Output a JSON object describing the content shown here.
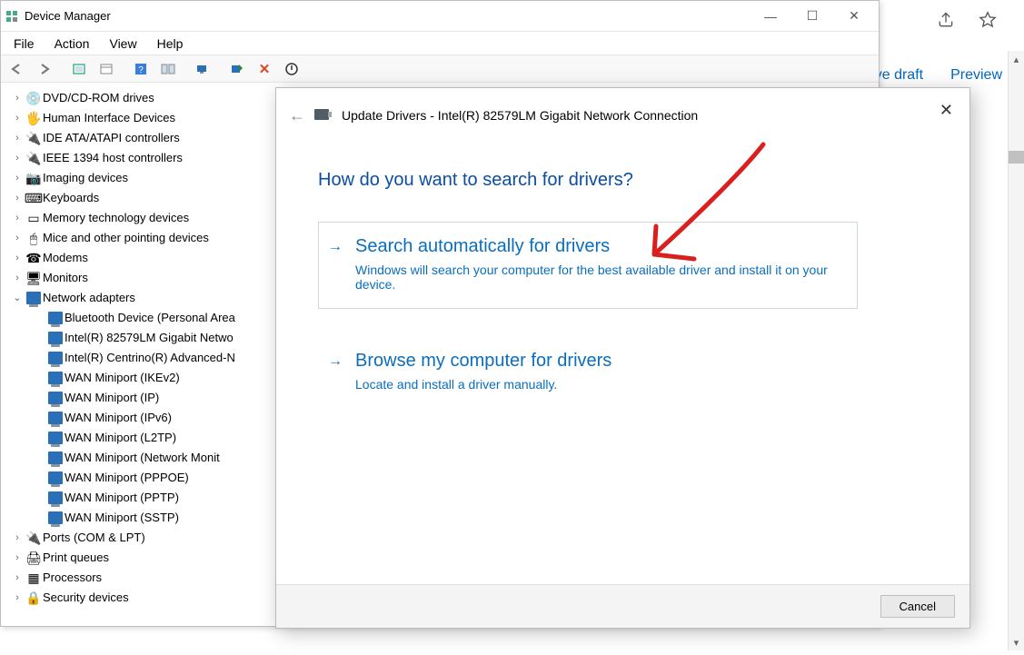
{
  "bg": {
    "link1": "ve draft",
    "link2": "Preview"
  },
  "window": {
    "title": "Device Manager",
    "menus": [
      "File",
      "Action",
      "View",
      "Help"
    ]
  },
  "tree": [
    {
      "icon": "disc",
      "label": "DVD/CD-ROM drives",
      "exp": "›"
    },
    {
      "icon": "hid",
      "label": "Human Interface Devices",
      "exp": "›"
    },
    {
      "icon": "ide",
      "label": "IDE ATA/ATAPI controllers",
      "exp": "›"
    },
    {
      "icon": "ieee",
      "label": "IEEE 1394 host controllers",
      "exp": "›"
    },
    {
      "icon": "img",
      "label": "Imaging devices",
      "exp": "›"
    },
    {
      "icon": "kb",
      "label": "Keyboards",
      "exp": "›"
    },
    {
      "icon": "mem",
      "label": "Memory technology devices",
      "exp": "›"
    },
    {
      "icon": "mouse",
      "label": "Mice and other pointing devices",
      "exp": "›"
    },
    {
      "icon": "modem",
      "label": "Modems",
      "exp": "›"
    },
    {
      "icon": "monitor",
      "label": "Monitors",
      "exp": "›"
    }
  ],
  "network": {
    "label": "Network adapters",
    "children": [
      "Bluetooth Device (Personal Area",
      "Intel(R) 82579LM Gigabit Netwo",
      "Intel(R) Centrino(R) Advanced-N",
      "WAN Miniport (IKEv2)",
      "WAN Miniport (IP)",
      "WAN Miniport (IPv6)",
      "WAN Miniport (L2TP)",
      "WAN Miniport (Network Monit",
      "WAN Miniport (PPPOE)",
      "WAN Miniport (PPTP)",
      "WAN Miniport (SSTP)"
    ]
  },
  "tree2": [
    {
      "icon": "port",
      "label": "Ports (COM & LPT)",
      "exp": "›"
    },
    {
      "icon": "print",
      "label": "Print queues",
      "exp": "›"
    },
    {
      "icon": "cpu",
      "label": "Processors",
      "exp": "›"
    },
    {
      "icon": "sec",
      "label": "Security devices",
      "exp": "›"
    }
  ],
  "dialog": {
    "title": "Update Drivers - Intel(R) 82579LM Gigabit Network Connection",
    "prompt": "How do you want to search for drivers?",
    "opt1_title": "Search automatically for drivers",
    "opt1_desc": "Windows will search your computer for the best available driver and install it on your device.",
    "opt2_title": "Browse my computer for drivers",
    "opt2_desc": "Locate and install a driver manually.",
    "cancel": "Cancel"
  }
}
